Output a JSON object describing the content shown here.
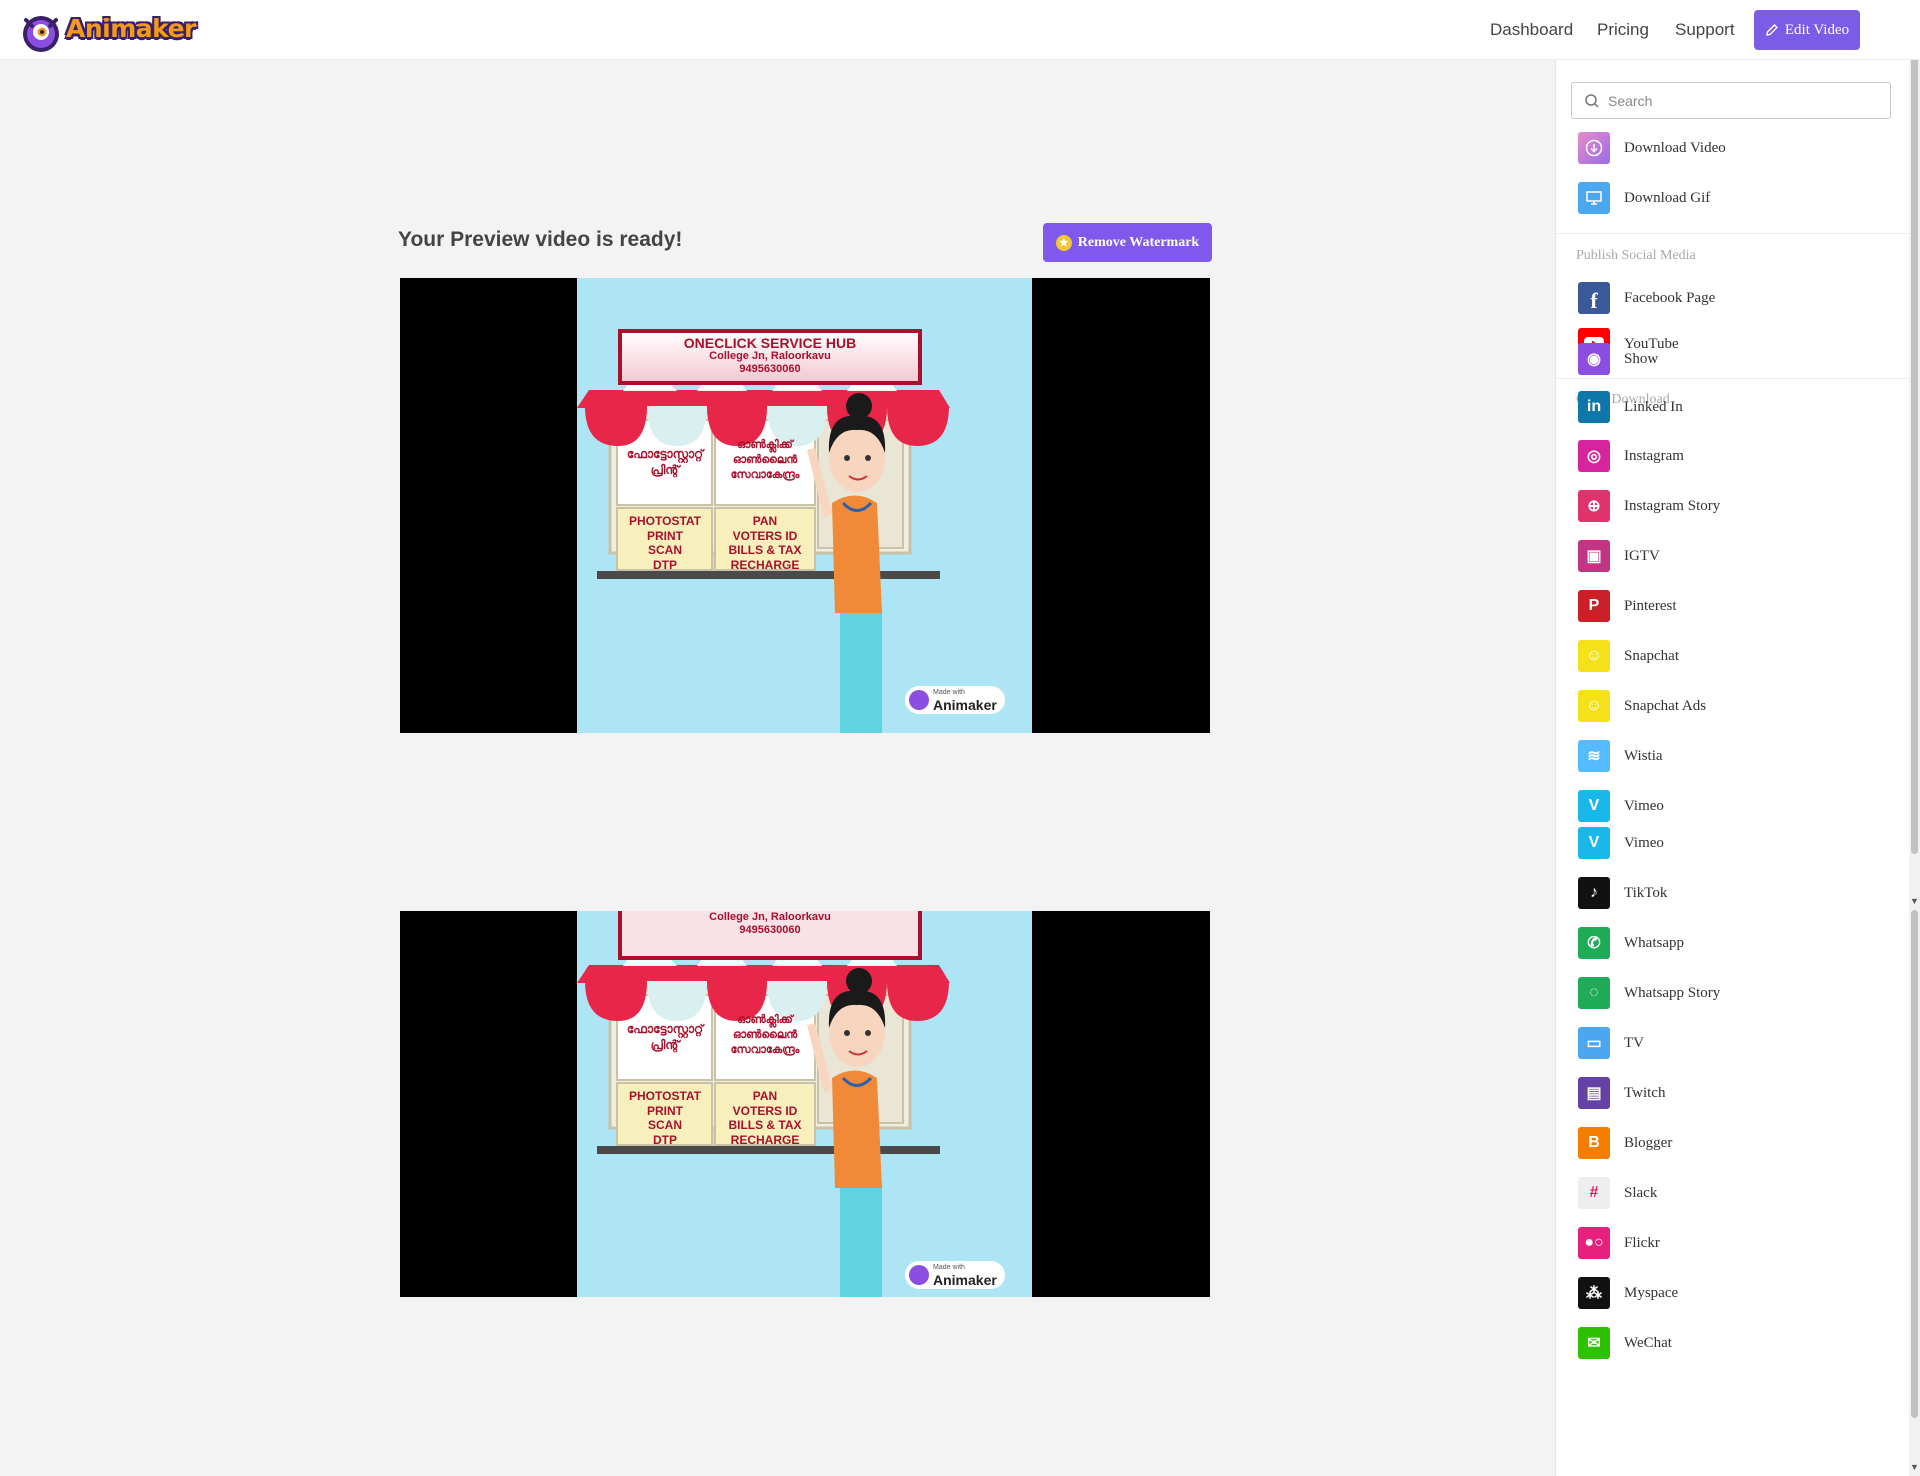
{
  "app": {
    "brand": "Animaker"
  },
  "topbar": {
    "nav": [
      "Dashboard",
      "Pricing",
      "Support"
    ],
    "edit_label": "Edit Video"
  },
  "main": {
    "title": "Your Preview video is ready!",
    "remove_watermark_label": "Remove Watermark"
  },
  "scene": {
    "sign_title": "ONECLICK SERVICE HUB",
    "sign_line2": "College Jn, Raloorkavu",
    "sign_phone": "9495630060",
    "ml_left": "ഫോട്ടോസ്റ്റാറ്റ് പ്രിന്റ്",
    "ml_right": "ഓൺക്ലിക്ക് ഓൺലൈൻ സേവാകേന്ദ്രം",
    "services_left": [
      "PHOTOSTAT",
      "PRINT",
      "SCAN",
      "DTP"
    ],
    "services_right": [
      "PAN",
      "VOTERS ID",
      "BILLS & TAX",
      "RECHARGE"
    ],
    "watermark_small": "Made with",
    "watermark_brand": "Animaker"
  },
  "panel": {
    "search_placeholder": "Search",
    "downloads": [
      {
        "label": "Download Video",
        "icon": "download-icon",
        "color": "#c77de0"
      },
      {
        "label": "Download Gif",
        "icon": "monitor-icon",
        "color": "#4aa7f0"
      }
    ],
    "social_title": "Publish Social Media",
    "social": [
      {
        "label": "Facebook Page",
        "icon": "facebook-icon",
        "color": "#3b5998"
      },
      {
        "label": "YouTube",
        "icon": "youtube-icon",
        "color": "#ff0000"
      }
    ],
    "other_title": "Other Download",
    "other": [
      {
        "label": "Show",
        "icon": "show-icon",
        "color": "#8a4fe0"
      },
      {
        "label": "Linked In",
        "icon": "linkedin-icon",
        "color": "#0e76a8"
      },
      {
        "label": "Instagram",
        "icon": "instagram-icon",
        "color": "#d6249f"
      },
      {
        "label": "Instagram Story",
        "icon": "instagram-story-icon",
        "color": "#e0336c"
      },
      {
        "label": "IGTV",
        "icon": "igtv-icon",
        "color": "#c13584"
      },
      {
        "label": "Pinterest",
        "icon": "pinterest-icon",
        "color": "#cb2027"
      },
      {
        "label": "Snapchat",
        "icon": "snapchat-icon",
        "color": "#f5e11a"
      },
      {
        "label": "Snapchat Ads",
        "icon": "snapchat-ads-icon",
        "color": "#f5e11a"
      },
      {
        "label": "Wistia",
        "icon": "wistia-icon",
        "color": "#54bbff"
      },
      {
        "label": "Vimeo",
        "icon": "vimeo-icon",
        "color": "#1ab7ea"
      },
      {
        "label": "Vimeo",
        "icon": "vimeo-icon",
        "color": "#1ab7ea"
      },
      {
        "label": "TikTok",
        "icon": "tiktok-icon",
        "color": "#111111"
      },
      {
        "label": "Whatsapp",
        "icon": "whatsapp-icon",
        "color": "#1fab58"
      },
      {
        "label": "Whatsapp Story",
        "icon": "whatsapp-story-icon",
        "color": "#1fab58"
      },
      {
        "label": "TV",
        "icon": "tv-icon",
        "color": "#4aa7f0"
      },
      {
        "label": "Twitch",
        "icon": "twitch-icon",
        "color": "#6441a5"
      },
      {
        "label": "Blogger",
        "icon": "blogger-icon",
        "color": "#f57d00"
      },
      {
        "label": "Slack",
        "icon": "slack-icon",
        "color": "#eeeeee"
      },
      {
        "label": "Flickr",
        "icon": "flickr-icon",
        "color": "#e8207d"
      },
      {
        "label": "Myspace",
        "icon": "myspace-icon",
        "color": "#111111"
      },
      {
        "label": "WeChat",
        "icon": "wechat-icon",
        "color": "#2dc100"
      }
    ]
  }
}
